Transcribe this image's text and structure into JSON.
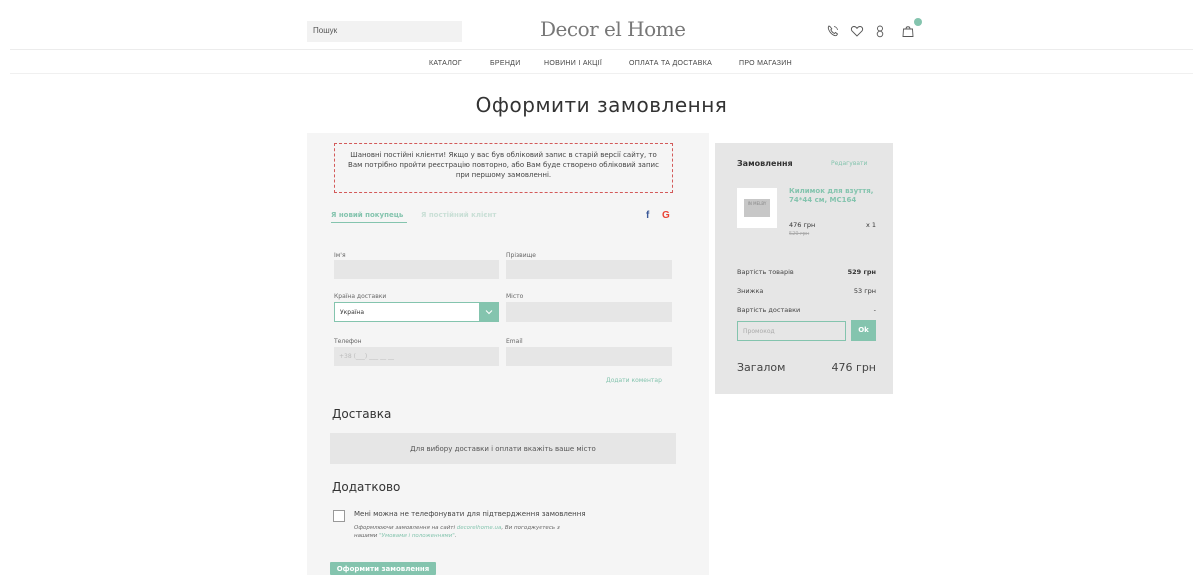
{
  "header": {
    "search_placeholder": "Пошук",
    "logo": "Decor el Home",
    "cart_count": "0"
  },
  "nav": {
    "items": [
      "КАТАЛОГ",
      "БРЕНДИ",
      "НОВИНИ І АКЦІЇ",
      "ОПЛАТА ТА ДОСТАВКА",
      "ПРО МАГАЗИН"
    ]
  },
  "page": {
    "title": "Оформити замовлення"
  },
  "notice": {
    "text": "Шановні постійні клієнти! Якщо у вас був обліковий запис в старій версії сайту, то Вам потрібно пройти реєстрацію повторно, або Вам буде створено обліковий запис при першому замовленні."
  },
  "tabs": {
    "new_buyer": "Я новий покупець",
    "returning": "Я постійний клієнт"
  },
  "social": {
    "facebook": "f",
    "google": "G"
  },
  "form": {
    "first_name_label": "Ім'я",
    "last_name_label": "Прізвище",
    "country_label": "Країна доставки",
    "country_value": "Україна",
    "city_label": "Місто",
    "phone_label": "Телефон",
    "phone_placeholder": "+38 (___) ___ __ __",
    "email_label": "Email",
    "add_comment": "Додати коментар"
  },
  "delivery": {
    "heading": "Доставка",
    "message": "Для вибору доставки і оплати вкажіть ваше місто"
  },
  "extra": {
    "heading": "Додатково",
    "no_call_label": "Мені можна не телефонувати для підтвердження замовлення",
    "terms_prefix": "Оформлюючи замовлення на сайті",
    "terms_site": "decorelhome.ua",
    "terms_mid": ", Ви погоджуєтесь з нашими",
    "terms_link": "\"Умовами і положеннями\"",
    "terms_end": "."
  },
  "submit": {
    "label": "Оформити замовлення"
  },
  "summary": {
    "title": "Замовлення",
    "edit": "Редагувати",
    "product": {
      "image_text": "IN MELBY",
      "name": "Килимок для взуття, 74*44 см, МС164",
      "price": "476 грн",
      "old_price": "529 грн",
      "qty": "x 1"
    },
    "goods_cost_label": "Вартість товарів",
    "goods_cost": "529 грн",
    "discount_label": "Знижка",
    "discount": "53 грн",
    "delivery_cost_label": "Вартість доставки",
    "delivery_cost": "-",
    "promo_placeholder": "Промокод",
    "promo_button": "Ok",
    "total_label": "Загалом",
    "total": "476 грн"
  },
  "colors": {
    "accent": "#84c4ae",
    "notice_border": "#d35a5a",
    "panel_bg": "#f5f5f5",
    "summary_bg": "#e6e6e6"
  }
}
